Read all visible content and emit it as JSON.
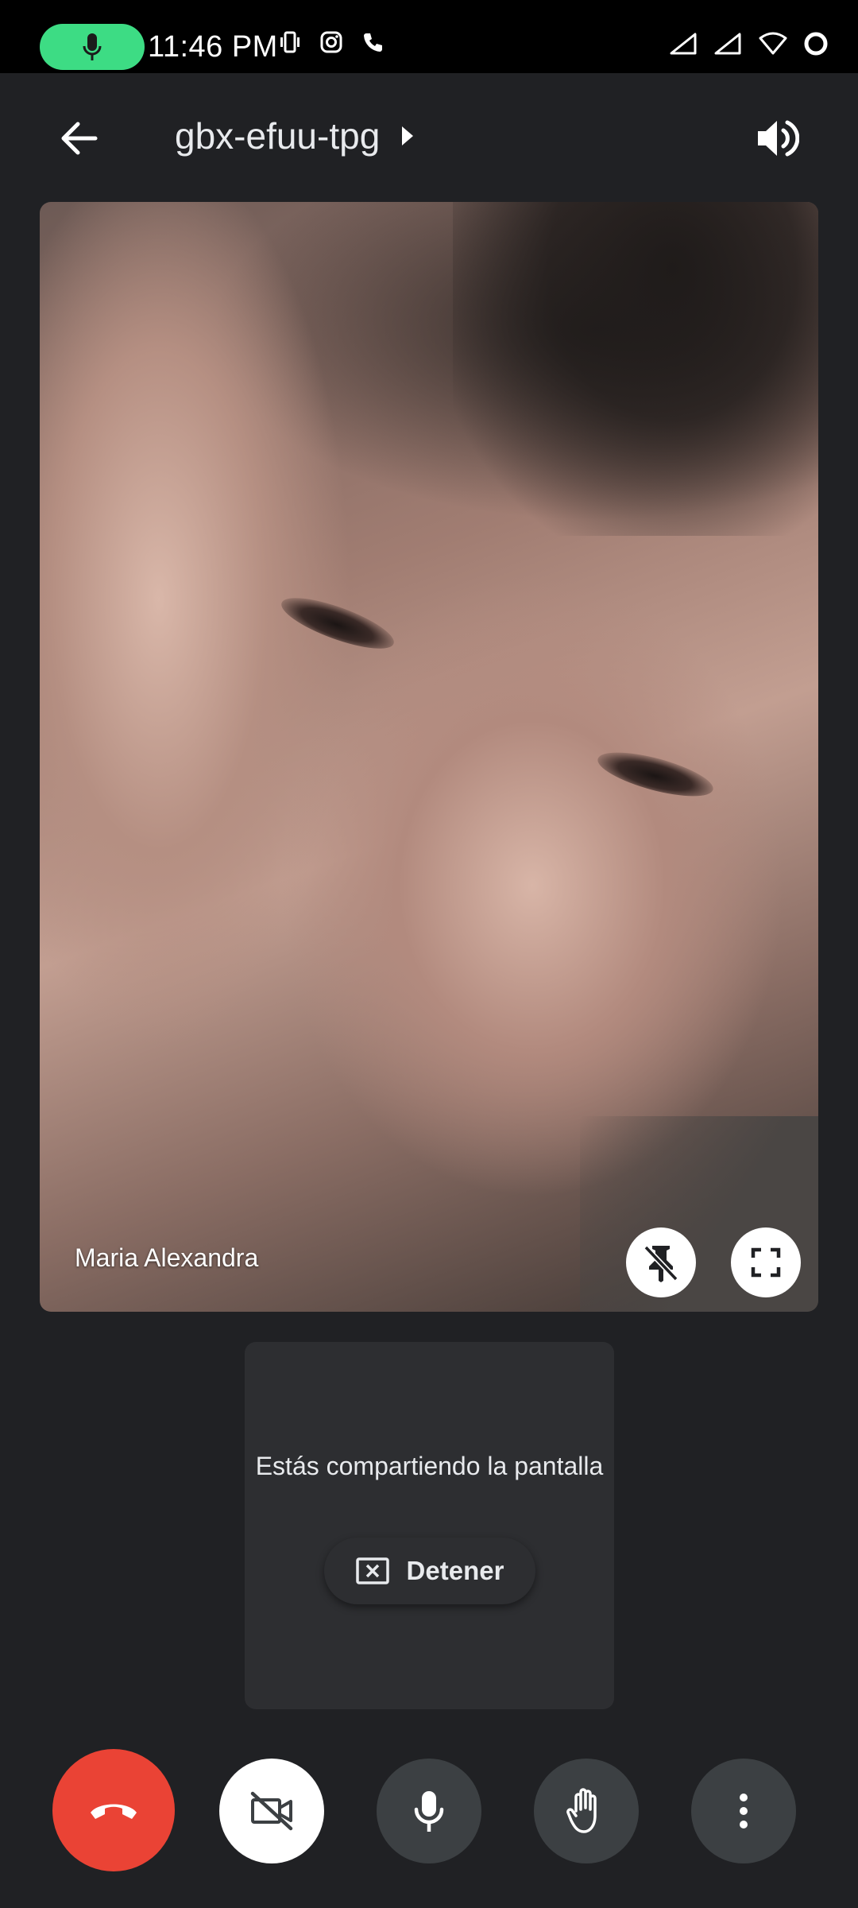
{
  "status_bar": {
    "time": "11:46 PM",
    "icons": [
      "mic-icon",
      "vibrate-icon",
      "instagram-icon",
      "phone-icon",
      "signal-icon",
      "signal-icon",
      "wifi-icon",
      "battery-icon"
    ],
    "accent_color": "#3ddc84"
  },
  "app_bar": {
    "meeting_code": "gbx-efuu-tpg"
  },
  "video": {
    "participant_name": "Maria Alexandra"
  },
  "share_card": {
    "message": "Estás compartiendo la pantalla",
    "stop_label": "Detener"
  },
  "controls": {
    "end_call_color": "#ea4335",
    "buttons": [
      "end-call",
      "camera-off",
      "microphone",
      "raise-hand",
      "more-options"
    ]
  }
}
